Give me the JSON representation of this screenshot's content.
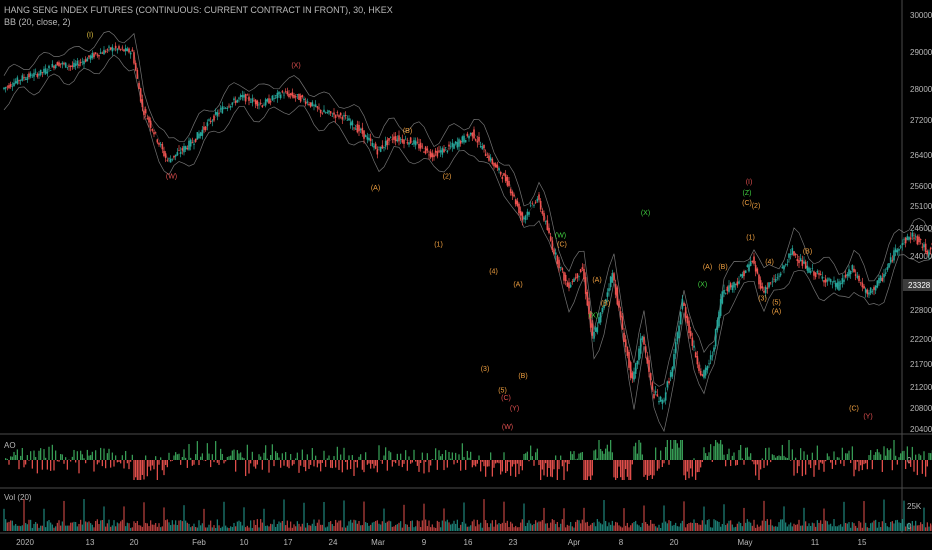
{
  "header": {
    "symbol_line": "HANG SENG INDEX FUTURES (CONTINUOUS: CURRENT CONTRACT IN FRONT), 30, HKEX",
    "indicator_line": "BB (20, close, 2)"
  },
  "panes": {
    "ao_label": "AO",
    "vol_label": "Vol (20)",
    "ao_zero_label": "0",
    "vol_ticks": [
      "25K",
      "0"
    ]
  },
  "colors": {
    "background": "#000000",
    "bull": "#26a69a",
    "bear": "#ef5350",
    "bb_band": "#9a9a9a",
    "price_tag": "#3c3c3c",
    "projection": "#c0392b",
    "wave_orange": "#f0a040",
    "wave_red": "#e05050",
    "wave_green": "#40d040",
    "wave_yellow": "#e0c040"
  },
  "chart_data": {
    "type": "candlestick",
    "title": "HANG SENG INDEX FUTURES (CONTINUOUS: CURRENT CONTRACT IN FRONT), 30, HKEX",
    "x_ticks": [
      "2020",
      "13",
      "20",
      "Feb",
      "10",
      "17",
      "24",
      "Mar",
      "9",
      "16",
      "23",
      "Apr",
      "8",
      "20",
      "May",
      "11",
      "15"
    ],
    "y_ticks": [
      30000,
      29000,
      28000,
      27200,
      26400,
      25600,
      25100,
      24600,
      24000,
      23328,
      22800,
      22200,
      21700,
      21200,
      20800,
      20400
    ],
    "y_range": [
      20400,
      30000
    ],
    "last_price": "23328",
    "price_path": [
      [
        0,
        28000
      ],
      [
        4,
        28300
      ],
      [
        8,
        28450
      ],
      [
        11,
        28700
      ],
      [
        14,
        28600
      ],
      [
        18,
        28900
      ],
      [
        22,
        29100
      ],
      [
        26,
        29000
      ],
      [
        28,
        27500
      ],
      [
        33,
        26250
      ],
      [
        38,
        26700
      ],
      [
        44,
        27500
      ],
      [
        48,
        27800
      ],
      [
        52,
        27600
      ],
      [
        56,
        27900
      ],
      [
        60,
        27750
      ],
      [
        64,
        27400
      ],
      [
        68,
        27300
      ],
      [
        72,
        26900
      ],
      [
        75,
        26500
      ],
      [
        78,
        26800
      ],
      [
        82,
        26700
      ],
      [
        86,
        26400
      ],
      [
        90,
        26600
      ],
      [
        94,
        26900
      ],
      [
        98,
        26200
      ],
      [
        101,
        25700
      ],
      [
        104,
        24800
      ],
      [
        107,
        25300
      ],
      [
        110,
        24200
      ],
      [
        113,
        23300
      ],
      [
        116,
        23700
      ],
      [
        118,
        22200
      ],
      [
        120,
        22800
      ],
      [
        122,
        23600
      ],
      [
        124,
        22400
      ],
      [
        126,
        21300
      ],
      [
        128,
        22300
      ],
      [
        130,
        21100
      ],
      [
        132,
        20900
      ],
      [
        134,
        21600
      ],
      [
        136,
        23000
      ],
      [
        138,
        22100
      ],
      [
        140,
        21400
      ],
      [
        142,
        21900
      ],
      [
        144,
        23200
      ],
      [
        147,
        23400
      ],
      [
        150,
        23900
      ],
      [
        152,
        23200
      ],
      [
        155,
        23500
      ],
      [
        158,
        24100
      ],
      [
        161,
        23700
      ],
      [
        164,
        23500
      ],
      [
        167,
        23300
      ],
      [
        170,
        23700
      ],
      [
        173,
        23100
      ],
      [
        176,
        23500
      ],
      [
        179,
        24200
      ],
      [
        182,
        24450
      ],
      [
        185,
        24100
      ],
      [
        188,
        24600
      ],
      [
        191,
        24400
      ],
      [
        193,
        24700
      ],
      [
        196,
        24250
      ],
      [
        199,
        24300
      ],
      [
        202,
        23800
      ],
      [
        205,
        23500
      ],
      [
        208,
        23900
      ],
      [
        211,
        24200
      ],
      [
        214,
        23850
      ],
      [
        217,
        24200
      ],
      [
        220,
        24350
      ],
      [
        223,
        24700
      ],
      [
        226,
        24550
      ],
      [
        228,
        24950
      ],
      [
        230,
        25300
      ],
      [
        232,
        24450
      ],
      [
        234,
        23700
      ],
      [
        236,
        23328
      ]
    ],
    "bb_offset": 450,
    "projection": [
      [
        236,
        23200
      ],
      [
        239,
        23700
      ],
      [
        243,
        23100
      ],
      [
        255,
        24000
      ],
      [
        275,
        20600
      ]
    ],
    "wave_labels": [
      {
        "t": 17.2,
        "v": 29400,
        "text": "(I)",
        "color": "wave_yellow"
      },
      {
        "t": 33.5,
        "v": 25800,
        "text": "(W)",
        "color": "wave_red"
      },
      {
        "t": 58.4,
        "v": 28580,
        "text": "(X)",
        "color": "wave_red"
      },
      {
        "t": 74.3,
        "v": 25500,
        "text": "(A)",
        "color": "wave_orange"
      },
      {
        "t": 80.7,
        "v": 26900,
        "text": "(B)",
        "color": "wave_orange"
      },
      {
        "t": 86.9,
        "v": 24200,
        "text": "(1)",
        "color": "wave_orange"
      },
      {
        "t": 88.6,
        "v": 25800,
        "text": "(2)",
        "color": "wave_orange"
      },
      {
        "t": 96.2,
        "v": 21550,
        "text": "(3)",
        "color": "wave_orange"
      },
      {
        "t": 97.9,
        "v": 23600,
        "text": "(4)",
        "color": "wave_orange"
      },
      {
        "t": 99.7,
        "v": 21100,
        "text": "(5)",
        "color": "wave_orange"
      },
      {
        "t": 100.4,
        "v": 20950,
        "text": "(C)",
        "color": "wave_red"
      },
      {
        "t": 102.1,
        "v": 20750,
        "text": "(Y)",
        "color": "wave_red"
      },
      {
        "t": 100.7,
        "v": 20400,
        "text": "(W)",
        "color": "wave_red"
      },
      {
        "t": 103.8,
        "v": 21400,
        "text": "(B)",
        "color": "wave_orange"
      },
      {
        "t": 102.8,
        "v": 23300,
        "text": "(A)",
        "color": "wave_orange"
      },
      {
        "t": 111.6,
        "v": 24200,
        "text": "(C)",
        "color": "wave_orange"
      },
      {
        "t": 111.3,
        "v": 24400,
        "text": "(W)",
        "color": "wave_green"
      },
      {
        "t": 118.6,
        "v": 23400,
        "text": "(A)",
        "color": "wave_orange"
      },
      {
        "t": 120.3,
        "v": 22900,
        "text": "(B)",
        "color": "wave_orange"
      },
      {
        "t": 117.9,
        "v": 22650,
        "text": "(X)",
        "color": "wave_green"
      },
      {
        "t": 128.3,
        "v": 24900,
        "text": "(X)",
        "color": "wave_green"
      },
      {
        "t": 140.7,
        "v": 23700,
        "text": "(A)",
        "color": "wave_orange"
      },
      {
        "t": 143.8,
        "v": 23700,
        "text": "(B)",
        "color": "wave_orange"
      },
      {
        "t": 139.7,
        "v": 23300,
        "text": "(X)",
        "color": "wave_green"
      },
      {
        "t": 149.0,
        "v": 25650,
        "text": "(I)",
        "color": "wave_red"
      },
      {
        "t": 148.6,
        "v": 25380,
        "text": "(Z)",
        "color": "wave_green"
      },
      {
        "t": 148.6,
        "v": 25130,
        "text": "(C)",
        "color": "wave_orange"
      },
      {
        "t": 150.4,
        "v": 25050,
        "text": "(2)",
        "color": "wave_orange"
      },
      {
        "t": 149.3,
        "v": 24350,
        "text": "(1)",
        "color": "wave_orange"
      },
      {
        "t": 153.1,
        "v": 23820,
        "text": "(4)",
        "color": "wave_orange"
      },
      {
        "t": 151.7,
        "v": 23000,
        "text": "(3)",
        "color": "wave_orange"
      },
      {
        "t": 154.5,
        "v": 22920,
        "text": "(5)",
        "color": "wave_orange"
      },
      {
        "t": 154.5,
        "v": 22730,
        "text": "(A)",
        "color": "wave_orange"
      },
      {
        "t": 160.7,
        "v": 24050,
        "text": "(B)",
        "color": "wave_orange"
      },
      {
        "t": 170.0,
        "v": 20750,
        "text": "(C)",
        "color": "wave_orange"
      },
      {
        "t": 172.8,
        "v": 20600,
        "text": "(Y)",
        "color": "wave_red"
      }
    ]
  }
}
